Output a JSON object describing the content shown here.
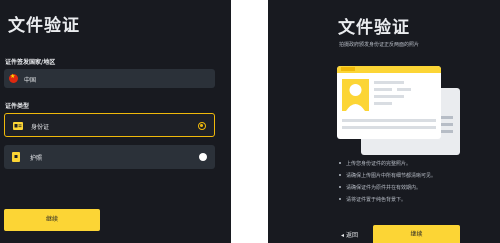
{
  "left": {
    "title": "文件验证",
    "country_label": "证件签发国家/地区",
    "country_value": "中国",
    "doc_type_label": "证件类型",
    "options": [
      {
        "label": "身份证",
        "selected": true,
        "icon": "id-card-icon"
      },
      {
        "label": "护照",
        "selected": false,
        "icon": "passport-icon"
      }
    ],
    "continue_label": "继续"
  },
  "right": {
    "title": "文件验证",
    "subtitle": "拍摄政府颁发身份证正反两面的照片",
    "tips": [
      "上传您身份证件的完整照片。",
      "请确保上传图片中所有细节都清晰可见。",
      "请确保证件为原件并在有效期内。",
      "请将证件置于纯色背景下。"
    ],
    "back_label": "返回",
    "back_icon": "chevron-left-icon",
    "continue_label": "继续",
    "illustration": "id-card-illustration"
  },
  "colors": {
    "panel_bg": "#181a20",
    "field_bg": "#2b3139",
    "accent": "#fcd535",
    "text": "#eaecef",
    "muted": "#b7bdc6"
  }
}
